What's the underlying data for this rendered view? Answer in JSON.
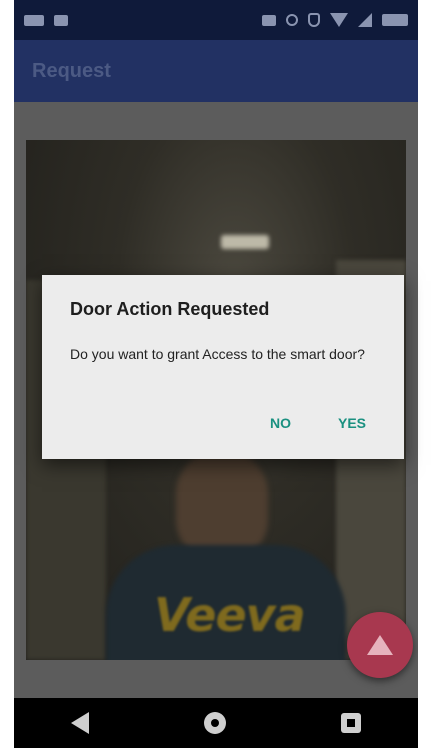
{
  "app_bar": {
    "title": "Request"
  },
  "dialog": {
    "title": "Door Action Requested",
    "message": "Do you want to grant Access to the smart door?",
    "negative_label": "NO",
    "positive_label": "YES"
  },
  "camera": {
    "shirt_text": "Veeva"
  },
  "colors": {
    "app_bar": "#223163",
    "status_bar": "#0f1a3a",
    "accent": "#1a9080",
    "fab": "#a8384f"
  },
  "icons": {
    "fab": "upload-icon",
    "nav": [
      "back-icon",
      "home-icon",
      "recents-icon"
    ]
  }
}
